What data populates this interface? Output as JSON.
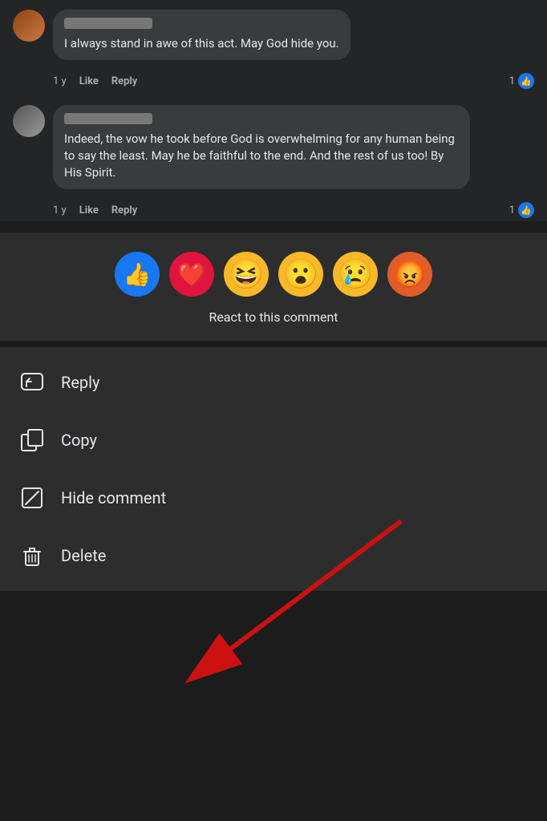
{
  "comments": [
    {
      "id": 1,
      "text": "I always stand in awe of this act. May God hide you.",
      "time": "1 y",
      "like_count": "1",
      "actions": [
        "Like",
        "Reply"
      ]
    },
    {
      "id": 2,
      "text": "Indeed, the vow he took before God is overwhelming for any human being to say the least. May he be faithful to the end. And the rest of us too! By His Spirit.",
      "time": "1 y",
      "like_count": "1",
      "actions": [
        "Like",
        "Reply"
      ]
    }
  ],
  "reaction_bar": {
    "label": "React to this comment",
    "reactions": [
      {
        "name": "like",
        "emoji": "👍",
        "label": "Like"
      },
      {
        "name": "love",
        "emoji": "❤️",
        "label": "Love"
      },
      {
        "name": "haha",
        "emoji": "😆",
        "label": "Haha"
      },
      {
        "name": "wow",
        "emoji": "😮",
        "label": "Wow"
      },
      {
        "name": "sad",
        "emoji": "😢",
        "label": "Sad"
      },
      {
        "name": "angry",
        "emoji": "😡",
        "label": "Angry"
      }
    ]
  },
  "menu": {
    "items": [
      {
        "id": "reply",
        "label": "Reply",
        "icon": "reply"
      },
      {
        "id": "copy",
        "label": "Copy",
        "icon": "copy"
      },
      {
        "id": "hide-comment",
        "label": "Hide comment",
        "icon": "hide"
      },
      {
        "id": "delete",
        "label": "Delete",
        "icon": "delete"
      }
    ]
  },
  "annotation": {
    "arrow_label": "Red arrow pointing to Hide comment"
  }
}
